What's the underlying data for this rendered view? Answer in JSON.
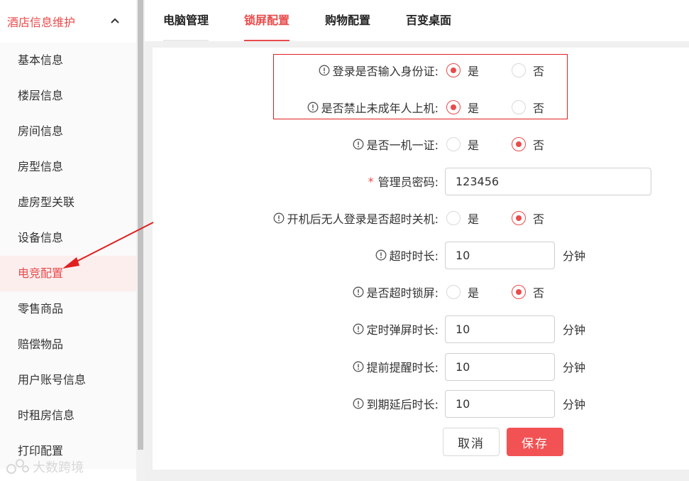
{
  "sidebar": {
    "header": "酒店信息维护",
    "items": [
      {
        "label": "基本信息"
      },
      {
        "label": "楼层信息"
      },
      {
        "label": "房间信息"
      },
      {
        "label": "房型信息"
      },
      {
        "label": "虚房型关联"
      },
      {
        "label": "设备信息"
      },
      {
        "label": "电竞配置",
        "active": true
      },
      {
        "label": "零售商品"
      },
      {
        "label": "赔偿物品"
      },
      {
        "label": "用户账号信息"
      },
      {
        "label": "时租房信息"
      },
      {
        "label": "打印配置"
      }
    ]
  },
  "tabs": [
    "电脑管理",
    "锁屏配置",
    "购物配置",
    "百变桌面"
  ],
  "active_tab": "锁屏配置",
  "form": {
    "yes": "是",
    "no": "否",
    "unit": "分钟",
    "id_login": {
      "label": "登录是否输入身份证:",
      "value": "是"
    },
    "forbid_minor": {
      "label": "是否禁止未成年人上机:",
      "value": "是"
    },
    "one_machine": {
      "label": "是否一机一证:",
      "value": "否"
    },
    "admin_password": {
      "label": "管理员密码:",
      "value": "123456"
    },
    "auto_shutdown": {
      "label": "开机后无人登录是否超时关机:",
      "value": "否"
    },
    "timeout_duration": {
      "label": "超时时长:",
      "value": "10"
    },
    "timeout_lock": {
      "label": "是否超时锁屏:",
      "value": "否"
    },
    "popup_duration": {
      "label": "定时弹屏时长:",
      "value": "10"
    },
    "remind_duration": {
      "label": "提前提醒时长:",
      "value": "10"
    },
    "extend_duration": {
      "label": "到期延后时长:",
      "value": "10"
    }
  },
  "buttons": {
    "cancel": "取消",
    "save": "保存"
  },
  "watermark": "大数跨境",
  "colors": {
    "accent": "#e94b4b",
    "save_button": "#f25253",
    "highlight_border": "#e02020"
  }
}
